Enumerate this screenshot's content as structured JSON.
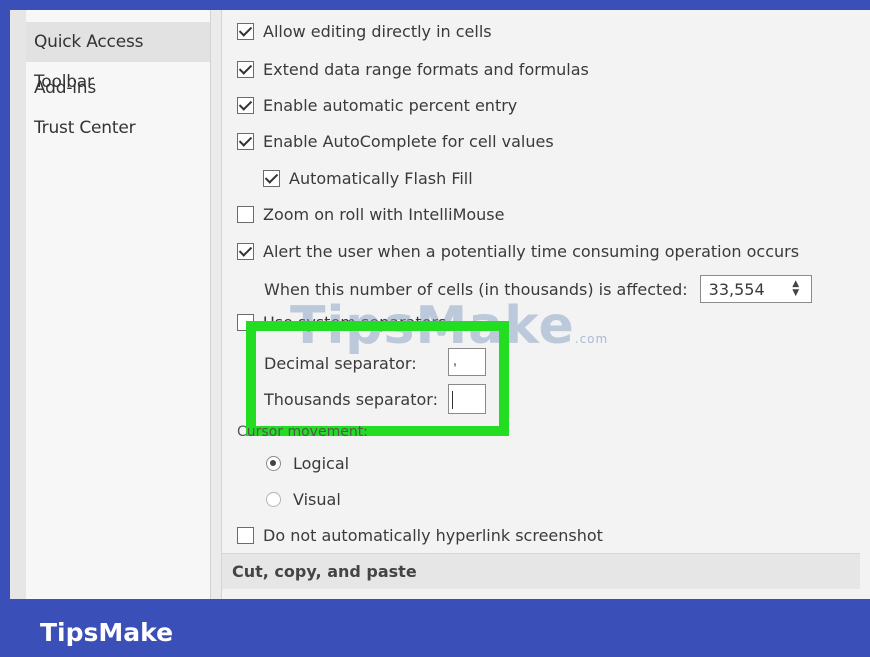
{
  "sidebar": {
    "items": [
      {
        "label": "Quick Access Toolbar",
        "selected": true
      },
      {
        "label": "Add-ins",
        "selected": false
      },
      {
        "label": "Trust Center",
        "selected": false
      }
    ]
  },
  "options": {
    "allow_editing": {
      "label": "Allow editing directly in cells",
      "checked": true
    },
    "extend_formats": {
      "label": "Extend data range formats and formulas",
      "checked": true
    },
    "percent_entry": {
      "label": "Enable automatic percent entry",
      "checked": true
    },
    "autocomplete": {
      "label": "Enable AutoComplete for cell values",
      "checked": true
    },
    "flash_fill": {
      "label": "Automatically Flash Fill",
      "checked": true
    },
    "zoom_roll": {
      "label": "Zoom on roll with IntelliMouse",
      "checked": false
    },
    "alert_user": {
      "label": "Alert the user when a potentially time consuming operation occurs",
      "checked": true
    },
    "cells_affected": {
      "label": "When this number of cells (in thousands) is affected:",
      "value": "33,554"
    },
    "custom_separators": {
      "label": "Use system separators",
      "checked": false
    },
    "decimal_separator": {
      "label": "Decimal separator:",
      "value": ","
    },
    "thousands_separator": {
      "label": "Thousands separator:",
      "value": ""
    },
    "cursor_movement": {
      "label": "Cursor movement:"
    },
    "logical": {
      "label": "Logical",
      "selected": true
    },
    "visual": {
      "label": "Visual",
      "selected": false
    },
    "no_hyperlink": {
      "label": "Do not automatically hyperlink screenshot",
      "checked": false
    }
  },
  "section": {
    "cut_copy_paste": "Cut, copy, and paste"
  },
  "watermark": {
    "text": "TipsMake",
    "suffix": ".com"
  },
  "brand": {
    "name": "TipsMake"
  },
  "colors": {
    "highlight": "#22dd22",
    "banner": "#3b4fb8"
  }
}
